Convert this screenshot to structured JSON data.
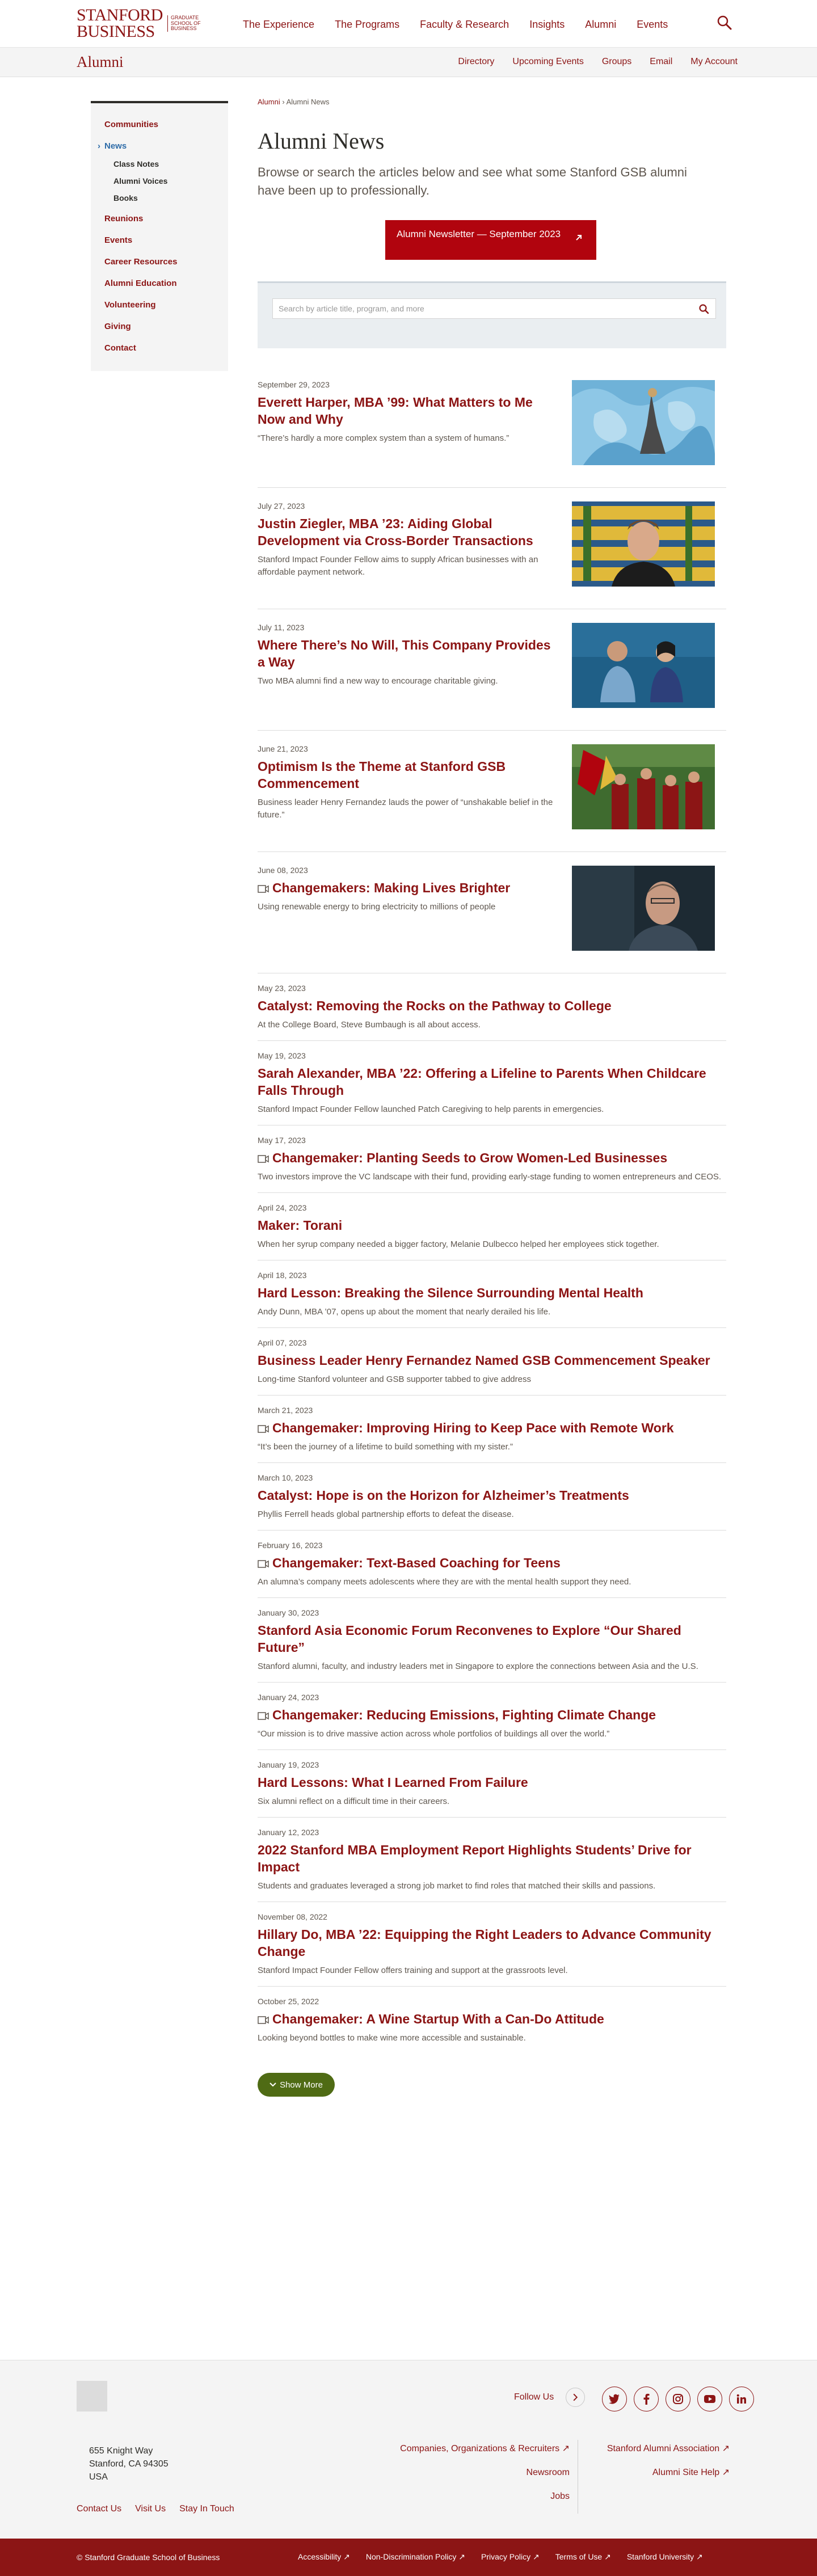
{
  "header": {
    "logo_line1": "STANFORD",
    "logo_line2": "BUSINESS",
    "logo_sub_line1": "GRADUATE",
    "logo_sub_line2": "SCHOOL OF",
    "logo_sub_line3": "BUSINESS",
    "nav": [
      "The Experience",
      "The Programs",
      "Faculty & Research",
      "Insights",
      "Alumni",
      "Events"
    ]
  },
  "alumni_bar": {
    "title": "Alumni",
    "links": [
      "Directory",
      "Upcoming Events",
      "Groups",
      "Email",
      "My Account"
    ]
  },
  "sidebar": {
    "communities": "Communities",
    "news": "News",
    "news_sub": [
      "Class Notes",
      "Alumni Voices",
      "Books"
    ],
    "rest": [
      "Reunions",
      "Events",
      "Career Resources",
      "Alumni Education",
      "Volunteering",
      "Giving",
      "Contact"
    ]
  },
  "breadcrumb": {
    "first": "Alumni",
    "sep": "›",
    "second": "Alumni News"
  },
  "page": {
    "title": "Alumni News",
    "intro": "Browse or search the articles below and see what some Stanford GSB alumni have been up to professionally.",
    "newsletter_label": "Alumni Newsletter — September 2023",
    "search_placeholder": "Search by article title, program, and more"
  },
  "featured_articles": [
    {
      "date": "September 29, 2023",
      "title": "Everett Harper, MBA ’99: What Matters to Me Now and Why",
      "desc": "“There’s hardly a more complex system than a system of humans.”",
      "video": false
    },
    {
      "date": "July 27, 2023",
      "title": "Justin Ziegler, MBA ’23: Aiding Global Development via Cross-Border Transactions",
      "desc": "Stanford Impact Founder Fellow aims to supply African businesses with an affordable payment network.",
      "video": false
    },
    {
      "date": "July 11, 2023",
      "title": "Where There’s No Will, This Company Provides a Way",
      "desc": "Two MBA alumni find a new way to encourage charitable giving.",
      "video": false
    },
    {
      "date": "June 21, 2023",
      "title": "Optimism Is the Theme at Stanford GSB Commencement",
      "desc": "Business leader Henry Fernandez lauds the power of “unshakable belief in the future.”",
      "video": false
    },
    {
      "date": "June 08, 2023",
      "title": "Changemakers: Making Lives Brighter",
      "desc": "Using renewable energy to bring electricity to millions of people",
      "video": true
    }
  ],
  "articles": [
    {
      "date": "May 23, 2023",
      "title": "Catalyst: Removing the Rocks on the Pathway to College",
      "desc": "At the College Board, Steve Bumbaugh is all about access.",
      "video": false
    },
    {
      "date": "May 19, 2023",
      "title": "Sarah Alexander, MBA ’22: Offering a Lifeline to Parents When Childcare Falls Through",
      "desc": "Stanford Impact Founder Fellow launched Patch Caregiving to help parents in emergencies.",
      "video": false
    },
    {
      "date": "May 17, 2023",
      "title": "Changemaker: Planting Seeds to Grow Women-Led Businesses",
      "desc": "Two investors improve the VC landscape with their fund, providing early-stage funding to women entrepreneurs and CEOS.",
      "video": true
    },
    {
      "date": "April 24, 2023",
      "title": "Maker: Torani",
      "desc": "When her syrup company needed a bigger factory, Melanie Dulbecco helped her employees stick together.",
      "video": false
    },
    {
      "date": "April 18, 2023",
      "title": "Hard Lesson: Breaking the Silence Surrounding Mental Health",
      "desc": "Andy Dunn, MBA ’07, opens up about the moment that nearly derailed his life.",
      "video": false
    },
    {
      "date": "April 07, 2023",
      "title": "Business Leader Henry Fernandez Named GSB Commencement Speaker",
      "desc": "Long-time Stanford volunteer and GSB supporter tabbed to give address",
      "video": false
    },
    {
      "date": "March 21, 2023",
      "title": "Changemaker: Improving Hiring to Keep Pace with Remote Work",
      "desc": "“It’s been the journey of a lifetime to build something with my sister.”",
      "video": true
    },
    {
      "date": "March 10, 2023",
      "title": "Catalyst: Hope is on the Horizon for Alzheimer’s Treatments",
      "desc": "Phyllis Ferrell heads global partnership efforts to defeat the disease.",
      "video": false
    },
    {
      "date": "February 16, 2023",
      "title": "Changemaker: Text-Based Coaching for Teens",
      "desc": "An alumna’s company meets adolescents where they are with the mental health support they need.",
      "video": true
    },
    {
      "date": "January 30, 2023",
      "title": "Stanford Asia Economic Forum Reconvenes to Explore “Our Shared Future”",
      "desc": "Stanford alumni, faculty, and industry leaders met in Singapore to explore the connections between Asia and the U.S.",
      "video": false
    },
    {
      "date": "January 24, 2023",
      "title": "Changemaker: Reducing Emissions, Fighting Climate Change",
      "desc": "“Our mission is to drive massive action across whole portfolios of buildings all over the world.”",
      "video": true
    },
    {
      "date": "January 19, 2023",
      "title": "Hard Lessons: What I Learned From Failure",
      "desc": "Six alumni reflect on a difficult time in their careers.",
      "video": false
    },
    {
      "date": "January 12, 2023",
      "title": "2022 Stanford MBA Employment Report Highlights Students’ Drive for Impact",
      "desc": "Students and graduates leveraged a strong job market to find roles that matched their skills and passions.",
      "video": false
    },
    {
      "date": "November 08, 2022",
      "title": "Hillary Do, MBA ’22: Equipping the Right Leaders to Advance Community Change",
      "desc": "Stanford Impact Founder Fellow offers training and support at the grassroots level.",
      "video": false
    },
    {
      "date": "October 25, 2022",
      "title": "Changemaker: A Wine Startup With a Can-Do Attitude",
      "desc": "Looking beyond bottles to make wine more accessible and sustainable.",
      "video": true
    }
  ],
  "show_more": "Show More",
  "footer": {
    "follow_label": "Follow Us",
    "social_icons": [
      "twitter-icon",
      "facebook-icon",
      "instagram-icon",
      "youtube-icon",
      "linkedin-icon"
    ],
    "address_line1": "655 Knight Way",
    "address_line2": "Stanford, CA 94305",
    "address_line3": "USA",
    "links_col1": [
      "Companies, Organizations & Recruiters ↗",
      "Newsroom",
      "Jobs"
    ],
    "links_col2": [
      "Stanford Alumni Association ↗",
      "Alumni Site Help ↗"
    ],
    "bottom_links": [
      "Contact Us",
      "Visit Us",
      "Stay In Touch"
    ],
    "copyright": "© Stanford Graduate School of Business",
    "legal_links": [
      "Accessibility ↗",
      "Non-Discrimination Policy ↗",
      "Privacy Policy ↗",
      "Terms of Use ↗",
      "Stanford University ↗"
    ]
  },
  "colors": {
    "brand": "#8c1515",
    "accent_button": "#b1040e",
    "show_more": "#4f6b14"
  }
}
